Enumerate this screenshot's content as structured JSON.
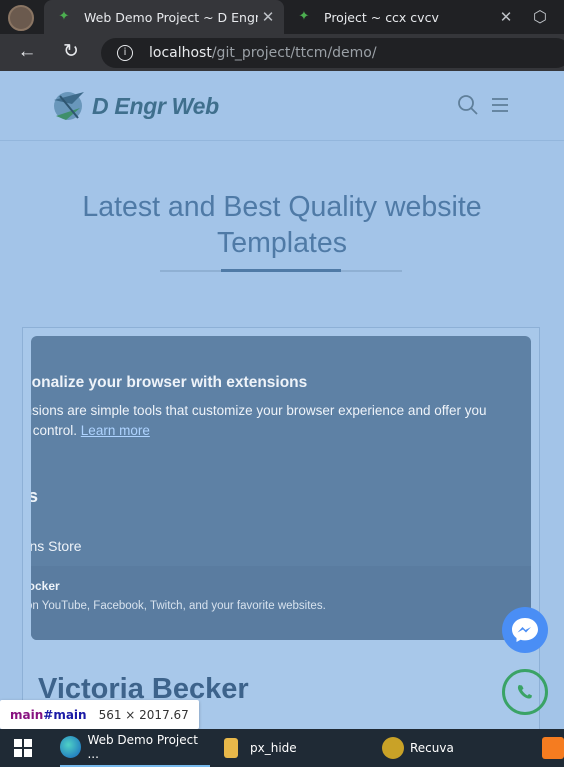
{
  "browser": {
    "tabs": [
      {
        "title": "Web Demo Project ~ D Engr We",
        "active": true
      },
      {
        "title": "Project  ~  ccx cvcv",
        "active": false
      }
    ],
    "url_host": "localhost",
    "url_path": "/git_project/ttcm/demo/"
  },
  "site": {
    "logo_text": "D Engr Web",
    "hero_title_line1": "Latest and Best Quality website",
    "hero_title_line2": "Templates",
    "card_name": "Victoria Becker"
  },
  "popup": {
    "title": "rsonalize your browser with extensions",
    "desc_line1": "ensions are simple tools that customize your browser experience and offer you",
    "desc_line2_prefix": "re control.",
    "desc_link": "Learn more",
    "heading": "ns",
    "store_label": "-ons Store",
    "ext_name": "blocker",
    "ext_desc": "s on YouTube, Facebook, Twitch, and your favorite websites."
  },
  "devtools": {
    "tag": "main",
    "id": "#main",
    "size": "561 × 2017.67"
  },
  "taskbar": {
    "items": [
      {
        "label": "Web Demo Project ..."
      },
      {
        "label": "px_hide"
      },
      {
        "label": "Recuva"
      }
    ]
  },
  "colors": {
    "page_bg": "#a3c4e8",
    "accent": "#4f7aa6",
    "popup_bg": "#5e81a5"
  }
}
